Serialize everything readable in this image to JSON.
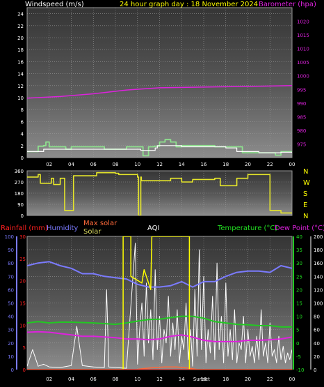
{
  "header": {
    "windspeed_label": "Windspeed (m/s)",
    "title": "24 hour graph day : 18 November 2024",
    "barometer_label": "Barometer (hpa)"
  },
  "lower_header": {
    "rainfall_label": "Rainfall (mm)",
    "humidity_label": "Humidity",
    "max_solar_label": "Max solar",
    "solar_label": "Solar",
    "aqi_label": "AQI",
    "temperature_label": "Temperature (°C)",
    "dewpoint_label": "Dew Point (°C)"
  },
  "direction_labels": [
    "N",
    "W",
    "S",
    "E",
    "N"
  ],
  "time_ticks": [
    "02",
    "04",
    "06",
    "08",
    "10",
    "12",
    "14",
    "16",
    "18",
    "20",
    "22",
    "00"
  ],
  "sun_labels": {
    "sunset": "Sunset"
  },
  "colors": {
    "windspeed": "#ffffff",
    "gust": "#8ee28e",
    "barometer": "#dd22dd",
    "direction": "#e6e62a",
    "rainfall": "#ff2020",
    "humidity": "#7b7bff",
    "solar": "#ffffff",
    "max_solar": "#ff6a3a",
    "aqi": "#ffff00",
    "temperature": "#22c822",
    "dewpoint": "#dd22dd"
  },
  "chart_data": [
    {
      "type": "line",
      "title": "24 hour graph day : 18 November 2024",
      "x_unit": "hour",
      "xlim": [
        0,
        24
      ],
      "ylim_left": [
        0,
        25
      ],
      "left_ticks": [
        0,
        2,
        4,
        6,
        8,
        10,
        12,
        14,
        16,
        18,
        20,
        22,
        24
      ],
      "ylim_right": [
        970,
        1025
      ],
      "right_ticks": [
        975,
        980,
        985,
        990,
        995,
        1000,
        1005,
        1010,
        1015,
        1020
      ],
      "series": [
        {
          "name": "Windspeed",
          "axis": "left",
          "x": [
            0,
            1.4,
            1.5,
            3.5,
            4,
            6.5,
            7,
            10,
            10.3,
            11.6,
            11.8,
            13,
            14,
            18,
            19,
            21,
            22,
            23,
            24
          ],
          "y": [
            1,
            1,
            1.4,
            1.4,
            1.4,
            1.4,
            1.4,
            1.4,
            1.2,
            1.6,
            2,
            2,
            1.8,
            1.6,
            1,
            0.8,
            0.8,
            0.9,
            0.8
          ]
        },
        {
          "name": "Gust",
          "axis": "left",
          "x": [
            0,
            0.5,
            1,
            1.5,
            1.7,
            2,
            3.5,
            4,
            6.5,
            7,
            8.5,
            9,
            10,
            10.5,
            11,
            11.5,
            12,
            12.5,
            13,
            13.5,
            14,
            16.5,
            17,
            19,
            19.5,
            21,
            21.5,
            22.5,
            23,
            24
          ],
          "y": [
            1,
            1,
            1.9,
            2,
            2.6,
            1.8,
            1.4,
            1.8,
            1.8,
            1.4,
            1.4,
            1.8,
            1.8,
            0.3,
            1.8,
            1.9,
            2.6,
            3,
            2.6,
            1.8,
            2,
            2,
            1.8,
            1.8,
            0.8,
            0.8,
            0.8,
            0.4,
            1,
            1
          ]
        },
        {
          "name": "Barometer",
          "axis": "right",
          "x": [
            0,
            3,
            6,
            9,
            12,
            15,
            18,
            21,
            24
          ],
          "y": [
            991.8,
            992.4,
            993.4,
            994.8,
            995.6,
            995.8,
            996,
            996.2,
            996.4
          ]
        }
      ]
    },
    {
      "type": "line",
      "name": "Wind direction",
      "xlim": [
        0,
        24
      ],
      "ylim": [
        0,
        360
      ],
      "ticks": [
        0,
        90,
        180,
        270,
        360
      ],
      "series": [
        {
          "name": "Direction",
          "x": [
            0,
            1,
            1.2,
            2.2,
            2.4,
            3,
            3.4,
            4,
            4.2,
            6,
            6.3,
            8,
            8.3,
            10,
            10.1,
            10.3,
            10.35,
            11,
            12,
            13,
            14,
            15,
            16,
            17,
            17.5,
            18,
            19,
            20,
            21,
            22,
            23,
            24
          ],
          "y": [
            310,
            330,
            260,
            300,
            250,
            300,
            40,
            40,
            320,
            320,
            345,
            340,
            330,
            310,
            0,
            310,
            280,
            280,
            280,
            300,
            270,
            290,
            290,
            300,
            240,
            240,
            300,
            330,
            330,
            40,
            20,
            20
          ]
        }
      ]
    },
    {
      "type": "line",
      "name": "Rain / Humidity / Solar / AQI / Temperature / Dew Point",
      "xlim": [
        0,
        24
      ],
      "axes": {
        "rainfall_ticks": [
          0,
          5,
          10,
          15,
          20,
          25,
          30
        ],
        "humidity_ticks": [
          0,
          10,
          20,
          30,
          40,
          50,
          60,
          70,
          80,
          90,
          100
        ],
        "temperature_ticks": [
          -10,
          -5,
          0,
          5,
          10,
          15,
          20,
          25,
          30,
          35,
          40
        ],
        "solar_ticks": [
          0,
          20,
          40,
          60,
          80,
          100,
          120,
          140,
          160,
          180,
          200
        ]
      },
      "series": [
        {
          "name": "Humidity",
          "axis": "humidity",
          "x": [
            0,
            1,
            2,
            3,
            4,
            5,
            6,
            7,
            8,
            9,
            10,
            11,
            12,
            13,
            14,
            15,
            16,
            17,
            18,
            19,
            20,
            21,
            22,
            23,
            24
          ],
          "y": [
            78,
            80,
            81,
            78,
            76,
            72,
            72,
            70,
            69,
            68,
            64,
            62,
            62,
            63,
            66,
            62,
            66,
            66,
            70,
            73,
            74,
            74,
            73,
            78,
            76
          ]
        },
        {
          "name": "Temperature",
          "axis": "temperature",
          "x": [
            0,
            1,
            2,
            3,
            4,
            6,
            8,
            9,
            10,
            11,
            12,
            13,
            14,
            15,
            16,
            17,
            18,
            19,
            20,
            21,
            22,
            23,
            24
          ],
          "y": [
            7.5,
            8,
            7.5,
            7.8,
            7.8,
            7.5,
            7,
            7.5,
            8.2,
            8.8,
            8.9,
            9.5,
            10,
            10,
            9.3,
            8,
            7.5,
            7,
            6.8,
            6.5,
            6.5,
            6,
            6
          ]
        },
        {
          "name": "Dew Point",
          "axis": "temperature",
          "x": [
            0,
            1,
            2,
            3,
            4,
            5,
            6,
            8,
            9,
            10,
            11,
            12,
            13,
            14,
            15,
            16,
            17,
            18,
            19,
            20,
            21,
            22,
            23,
            24
          ],
          "y": [
            4,
            4.2,
            4,
            3.5,
            3,
            2.5,
            2.5,
            2,
            1.5,
            1.5,
            1.2,
            1.5,
            2.5,
            3,
            2.2,
            1,
            0.5,
            0.5,
            0.5,
            1,
            1,
            1.2,
            1.5,
            2.2
          ]
        },
        {
          "name": "Solar",
          "axis": "solar",
          "x": [
            0,
            0.5,
            1,
            1.5,
            2,
            3,
            4,
            4.5,
            5,
            6,
            7,
            7.2,
            7.4,
            8,
            9,
            9.8,
            10,
            10.2,
            10.4,
            10.6,
            10.8,
            11,
            11.2,
            11.4,
            11.6,
            11.8,
            12,
            12.2,
            12.4,
            12.6,
            12.8,
            13,
            13.2,
            13.4,
            13.6,
            13.8,
            14,
            14.2,
            14.4,
            14.6,
            14.8,
            15,
            15.2,
            15.4,
            15.6,
            15.8,
            16,
            16.2,
            16.4,
            16.6,
            16.8,
            17,
            17.2,
            17.4,
            17.6,
            17.8,
            18,
            18.2,
            18.4,
            18.6,
            18.8,
            19,
            19.2,
            19.4,
            19.6,
            19.8,
            20,
            20.2,
            20.4,
            20.6,
            20.8,
            21,
            21.2,
            21.4,
            21.6,
            21.8,
            22,
            22.2,
            22.4,
            22.6,
            22.8,
            23,
            23.2,
            23.4,
            23.6,
            23.8,
            24
          ],
          "y": [
            5,
            30,
            5,
            8,
            4,
            3,
            6,
            65,
            6,
            4,
            3,
            120,
            4,
            3,
            2,
            190,
            8,
            60,
            100,
            20,
            130,
            40,
            90,
            15,
            150,
            30,
            80,
            10,
            60,
            40,
            110,
            20,
            70,
            30,
            90,
            10,
            50,
            30,
            100,
            15,
            60,
            5,
            120,
            20,
            180,
            30,
            140,
            10,
            60,
            25,
            110,
            15,
            160,
            30,
            80,
            10,
            130,
            20,
            60,
            15,
            90,
            10,
            40,
            30,
            80,
            10,
            60,
            20,
            35,
            10,
            50,
            15,
            90,
            20,
            40,
            10,
            70,
            20,
            30,
            10,
            50,
            15,
            35,
            10,
            25,
            15,
            30
          ]
        },
        {
          "name": "Max solar",
          "axis": "solar",
          "x": [
            0,
            9.8,
            10.5,
            11.5,
            12.5,
            13.5,
            14.5,
            15.5,
            24
          ],
          "y": [
            0,
            0,
            1.5,
            3,
            4,
            4,
            2.5,
            0,
            0
          ]
        },
        {
          "name": "AQI",
          "axis": "aqi",
          "x": [
            0,
            8.7,
            8.7,
            9.4,
            9.4,
            10.4,
            10.5,
            10.6,
            11.2,
            11.3,
            11.4,
            11.5,
            12,
            14.7,
            14.7,
            24
          ],
          "y": [
            0,
            0,
            200,
            200,
            140,
            130,
            140,
            150,
            120,
            200,
            200,
            200,
            200,
            200,
            0,
            0
          ]
        },
        {
          "name": "Rainfall",
          "axis": "rainfall",
          "x": [
            0,
            24
          ],
          "y": [
            0,
            0
          ]
        }
      ]
    }
  ]
}
